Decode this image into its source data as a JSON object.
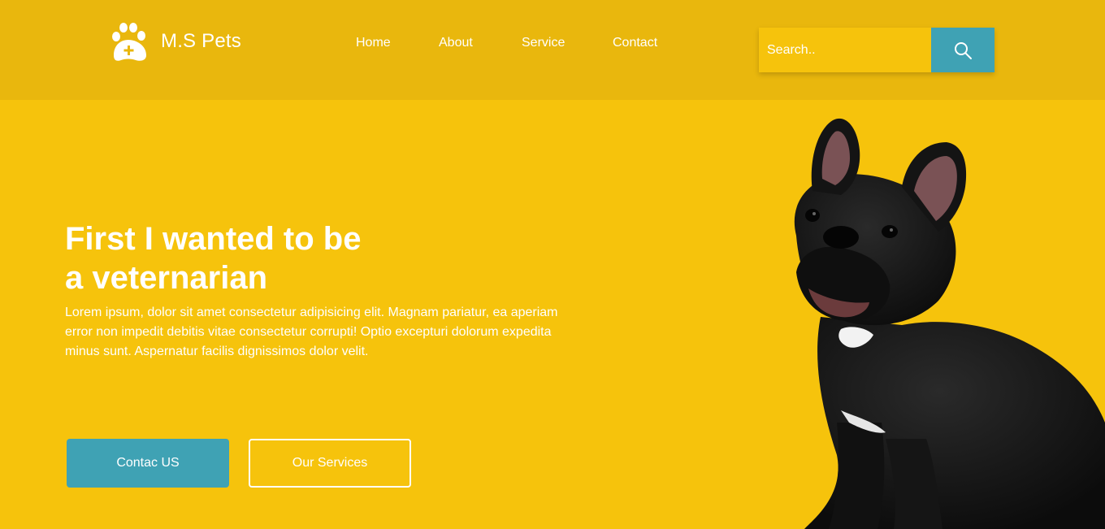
{
  "brand": {
    "name": "M.S Pets",
    "icon": "paw-plus-icon"
  },
  "nav": {
    "items": [
      {
        "label": "Home"
      },
      {
        "label": "About"
      },
      {
        "label": "Service"
      },
      {
        "label": "Contact"
      }
    ]
  },
  "search": {
    "placeholder": "Search..",
    "icon": "search-icon"
  },
  "hero": {
    "title_line1": "First I wanted to be",
    "title_line2": "a veternarian",
    "body": "Lorem ipsum, dolor sit amet consectetur adipisicing elit. Magnam pariatur, ea aperiam error non impedit debitis vitae consectetur corrupti! Optio excepturi dolorum expedita minus sunt. Aspernatur facilis dignissimos dolor velit.",
    "primary_button": "Contac US",
    "secondary_button": "Our Services"
  },
  "colors": {
    "header_bg": "#e9b70d",
    "page_bg": "#f6c30c",
    "accent": "#3fa2b4",
    "text": "#ffffff"
  }
}
